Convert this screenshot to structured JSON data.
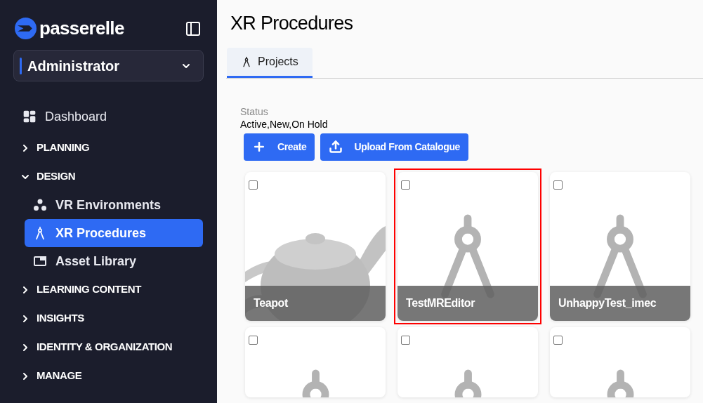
{
  "sidebar": {
    "brand": "passerelle",
    "role_select": {
      "value": "Administrator"
    },
    "items": [
      {
        "kind": "link",
        "label": "Dashboard",
        "selected": false
      },
      {
        "kind": "section",
        "label": "PLANNING",
        "expanded": false
      },
      {
        "kind": "section",
        "label": "DESIGN",
        "expanded": true,
        "children": [
          {
            "kind": "link",
            "label": "VR Environments",
            "selected": false
          },
          {
            "kind": "link",
            "label": "XR Procedures",
            "selected": true
          },
          {
            "kind": "link",
            "label": "Asset Library",
            "selected": false
          }
        ]
      },
      {
        "kind": "section",
        "label": "LEARNING CONTENT",
        "expanded": false
      },
      {
        "kind": "section",
        "label": "INSIGHTS",
        "expanded": false
      },
      {
        "kind": "section",
        "label": "IDENTITY & ORGANIZATION",
        "expanded": false
      },
      {
        "kind": "section",
        "label": "MANAGE",
        "expanded": false
      }
    ]
  },
  "page": {
    "title": "XR Procedures",
    "tabs": [
      {
        "label": "Projects",
        "selected": true
      }
    ],
    "status_filter": {
      "label": "Status",
      "value": "Active,New,On Hold"
    },
    "buttons": [
      {
        "label": "Create"
      },
      {
        "label": "Upload From Catalogue"
      }
    ],
    "cards": [
      {
        "kind": "model",
        "title": "Teapot",
        "checked": false,
        "highlighted": false
      },
      {
        "kind": "placeholder",
        "title": "TestMREditor",
        "checked": false,
        "highlighted": true
      },
      {
        "kind": "placeholder",
        "title": "UnhappyTest_imec",
        "checked": false,
        "highlighted": false
      },
      {
        "kind": "placeholder",
        "checked": false,
        "highlighted": false
      },
      {
        "kind": "placeholder",
        "checked": false,
        "highlighted": false
      },
      {
        "kind": "placeholder",
        "checked": false,
        "highlighted": false
      }
    ]
  }
}
